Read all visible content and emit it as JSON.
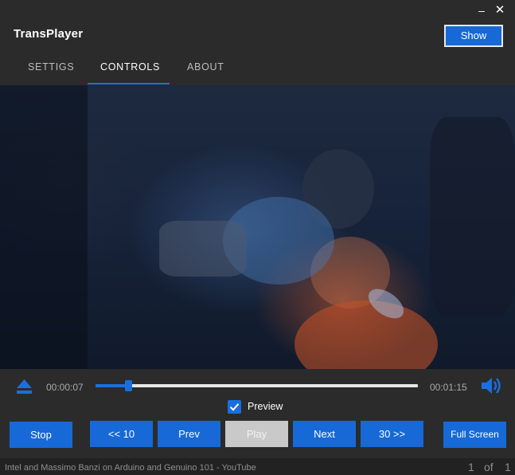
{
  "window": {
    "title": "TransPlayer",
    "minimize_glyph": "–",
    "close_glyph": "✕",
    "show_label": "Show"
  },
  "tabs": [
    {
      "label": "SETTIGS",
      "active": false
    },
    {
      "label": "CONTROLS",
      "active": true
    },
    {
      "label": "ABOUT",
      "active": false
    }
  ],
  "player": {
    "current_time": "00:00:07",
    "total_time": "00:01:15",
    "progress_fraction": 0.093,
    "preview_label": "Preview",
    "preview_checked": true,
    "buttons": {
      "stop": "Stop",
      "back10": "<< 10",
      "prev": "Prev",
      "play": "Play",
      "next": "Next",
      "fwd30": "30 >>",
      "fullscreen": "Full Screen"
    }
  },
  "status": {
    "video_title": "Intel and Massimo Banzi on Arduino and Genuino 101 - YouTube",
    "page_current": "1",
    "page_of": "of",
    "page_total": "1"
  },
  "colors": {
    "accent": "#1a6fe0",
    "button": "#1669d6",
    "background": "#2b2b2b",
    "disabled": "#c9c9c9"
  },
  "icons": {
    "eject": "eject-icon",
    "volume": "volume-icon",
    "checkbox": "checkmark-icon"
  }
}
